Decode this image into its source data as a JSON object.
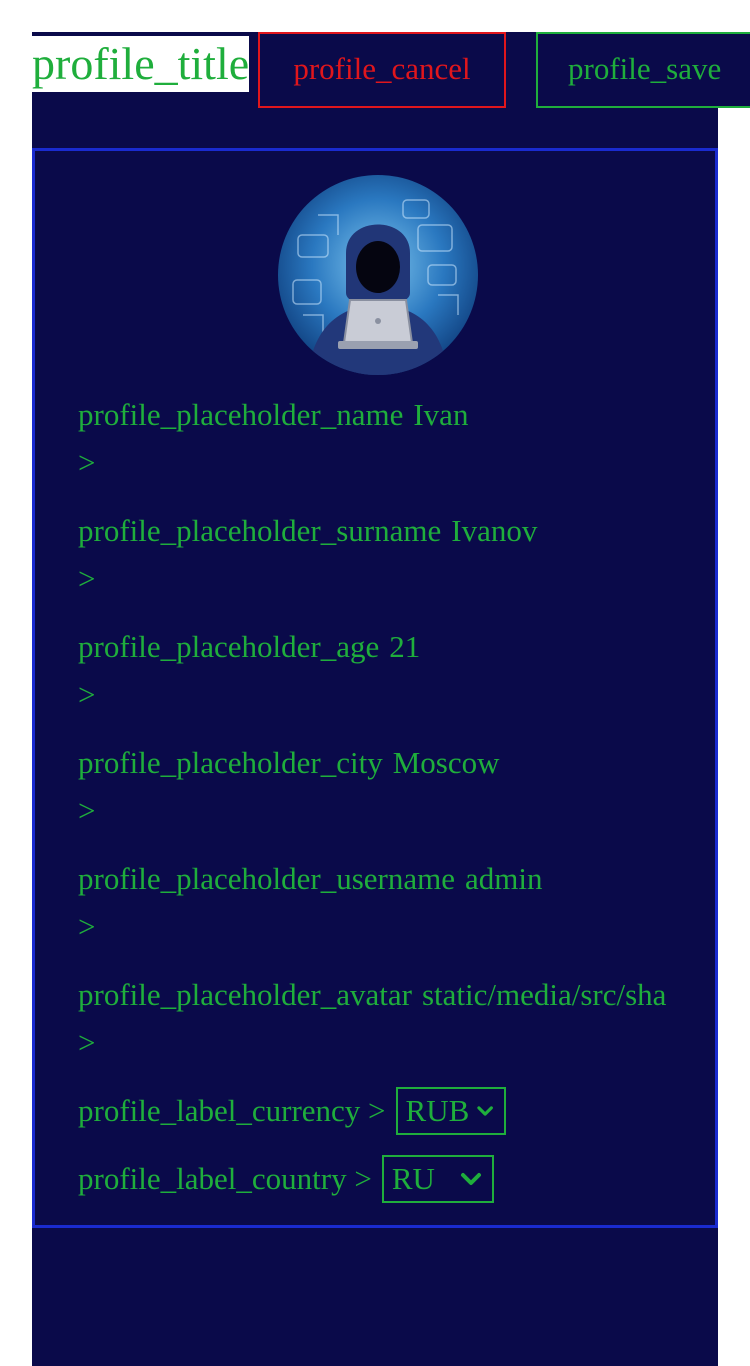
{
  "header": {
    "title": "profile_title",
    "cancel_label": "profile_cancel",
    "save_label": "profile_save"
  },
  "form": {
    "fields": [
      {
        "label": "profile_placeholder_name",
        "value": "Ivan",
        "arrow": ">"
      },
      {
        "label": "profile_placeholder_surname",
        "value": "Ivanov",
        "arrow": ">"
      },
      {
        "label": "profile_placeholder_age",
        "value": "21",
        "arrow": ">"
      },
      {
        "label": "profile_placeholder_city",
        "value": "Moscow",
        "arrow": ">"
      },
      {
        "label": "profile_placeholder_username",
        "value": "admin",
        "arrow": ">"
      },
      {
        "label": "profile_placeholder_avatar",
        "value": "static/media/src/sha",
        "arrow": ">"
      }
    ],
    "currency": {
      "label": "profile_label_currency >",
      "selected": "RUB"
    },
    "country": {
      "label": "profile_label_country >",
      "selected": "RU"
    }
  },
  "colors": {
    "background": "#0a0a4a",
    "text_green": "#1fae3c",
    "cancel_red": "#e0161c",
    "card_border": "#1a2bd0"
  },
  "icons": {
    "avatar": "hacker-avatar-image",
    "select": "chevron-down-icon"
  }
}
